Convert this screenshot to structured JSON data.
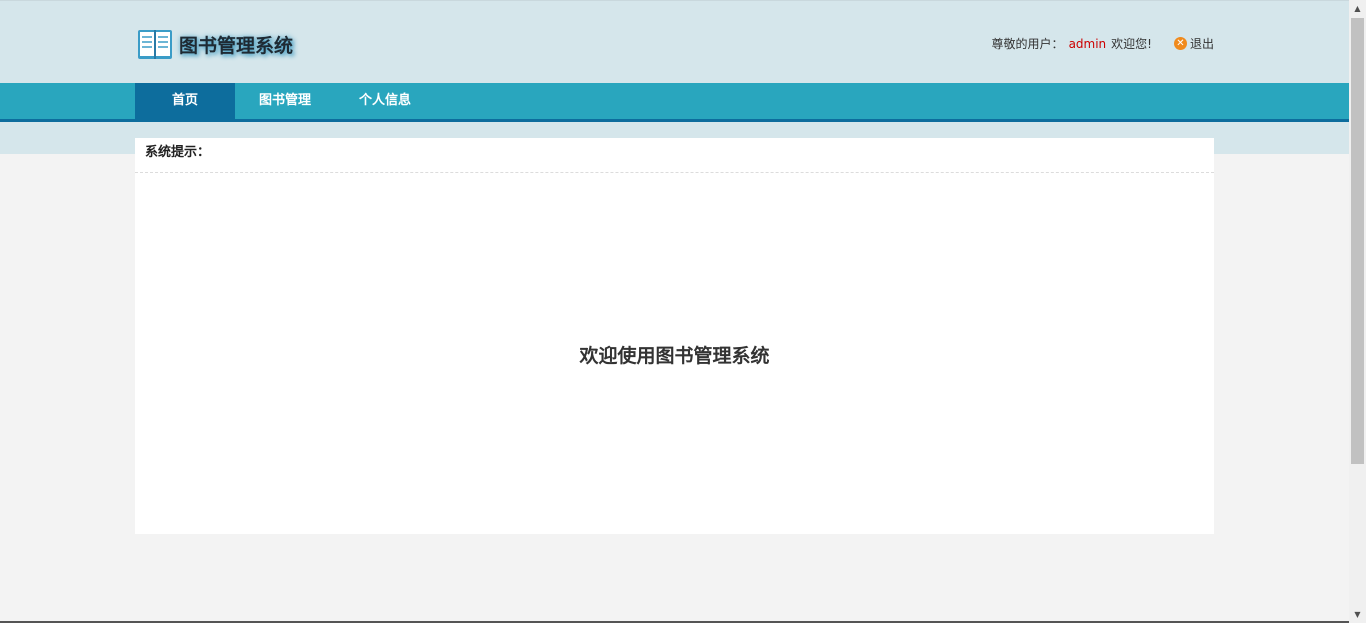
{
  "app": {
    "title": "图书管理系统"
  },
  "header": {
    "user_prefix": "尊敬的用户：",
    "user_name": "admin",
    "welcome_suffix": "欢迎您!",
    "logout_label": "退出"
  },
  "nav": {
    "items": [
      {
        "label": "首页",
        "active": true
      },
      {
        "label": "图书管理",
        "active": false
      },
      {
        "label": "个人信息",
        "active": false
      }
    ]
  },
  "panel": {
    "title": "系统提示：",
    "welcome_text": "欢迎使用图书管理系统"
  },
  "colors": {
    "header_bg": "#d5e6eb",
    "nav_bg": "#29a6be",
    "nav_active": "#0d6d9d",
    "username": "#cc0000",
    "logout_icon": "#f08a1c"
  },
  "icons": {
    "logo": "book-icon",
    "logout": "close-circle-icon"
  }
}
